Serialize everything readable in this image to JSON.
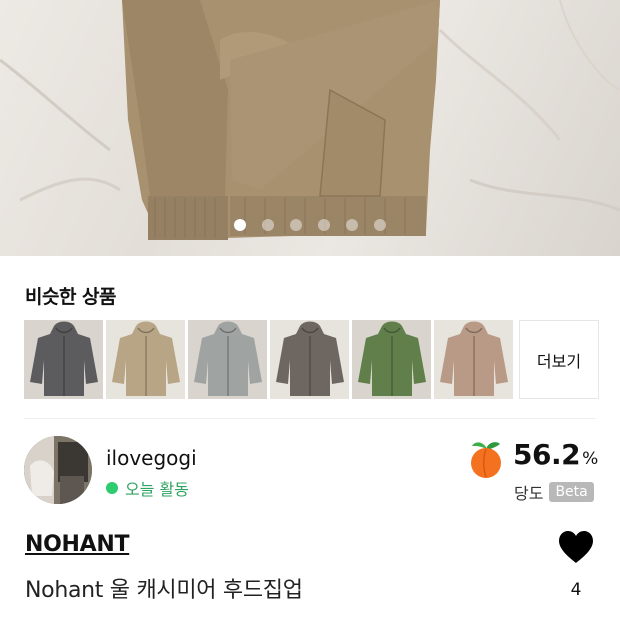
{
  "carousel": {
    "page_count": 6,
    "active_index": 0
  },
  "similar": {
    "title": "비슷한 상품",
    "more_label": "더보기",
    "items": [
      {
        "color": "#5c5c5f",
        "icon": "hoodie-thumbnail"
      },
      {
        "color": "#b8a585",
        "icon": "hoodie-thumbnail"
      },
      {
        "color": "#9fa3a2",
        "icon": "hoodie-thumbnail"
      },
      {
        "color": "#6e6661",
        "icon": "hoodie-thumbnail"
      },
      {
        "color": "#607f4a",
        "icon": "hoodie-thumbnail"
      },
      {
        "color": "#b89a86",
        "icon": "hoodie-thumbnail"
      }
    ]
  },
  "seller": {
    "name": "ilovegogi",
    "activity": "오늘 활동",
    "activity_color": "#2ecc71",
    "score": "56.2",
    "score_unit": "%",
    "score_label": "당도",
    "beta_label": "Beta",
    "score_icon": "peach-icon"
  },
  "product": {
    "brand": "NOHANT",
    "title": "Nohant 울 캐시미어 후드집업",
    "like_count": "4",
    "like_icon": "heart-icon"
  },
  "colors": {
    "accent_green": "#2ecc71",
    "peach": "#f4711f",
    "sweater": "#a58f6e"
  }
}
